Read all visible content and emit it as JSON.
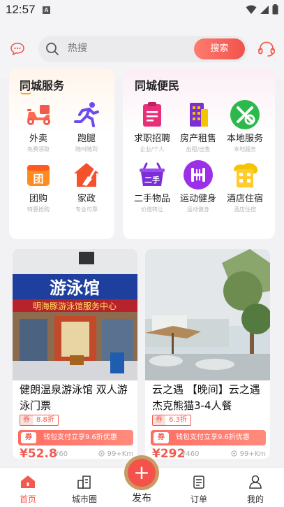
{
  "status": {
    "time": "12:57",
    "notif_badge": "A"
  },
  "search": {
    "placeholder": "热搜",
    "button": "搜索"
  },
  "icons": {
    "message": "message-icon",
    "customer_service": "headset-icon",
    "search": "search-icon"
  },
  "city_service": {
    "title": "同城服务",
    "items": [
      {
        "label": "外卖",
        "sub": "免费领取",
        "icon": "scooter-icon"
      },
      {
        "label": "跑腿",
        "sub": "随叫随到",
        "icon": "runner-icon"
      },
      {
        "label": "团购",
        "sub": "特惠抢购",
        "icon": "group-buy-icon"
      },
      {
        "label": "家政",
        "sub": "专业可靠",
        "icon": "broom-icon"
      }
    ]
  },
  "city_convenience": {
    "title": "同城便民",
    "items": [
      {
        "label": "求职招聘",
        "sub": "企业/个人",
        "icon": "job-icon"
      },
      {
        "label": "房产租售",
        "sub": "出租/出售",
        "icon": "building-icon"
      },
      {
        "label": "本地服务",
        "sub": "本地服务",
        "icon": "tools-icon"
      },
      {
        "label": "二手物品",
        "sub": "价值转让",
        "icon": "basket-icon"
      },
      {
        "label": "运动健身",
        "sub": "运动健身",
        "icon": "fitness-icon"
      },
      {
        "label": "酒店住宿",
        "sub": "酒店住宿",
        "icon": "hotel-icon"
      }
    ]
  },
  "products": [
    {
      "title": "健朗温泉游泳馆 双人游泳门票",
      "coupon_tag": "券",
      "coupon_value": "8.8折",
      "pay_icon": "券",
      "pay_text": "钱包支付立享9.6折优惠",
      "price": "¥52.8",
      "old_price": "¥60",
      "distance": "99+Km",
      "sign_text": "游泳馆",
      "banner_text": "明海豚游泳馆服务中心"
    },
    {
      "title": "云之遇 【晚间】云之遇杰克熊猫3-4人餐",
      "coupon_tag": "券",
      "coupon_value": "6.3折",
      "pay_icon": "券",
      "pay_text": "钱包支付立享9.6折优惠",
      "price": "¥292",
      "old_price": "¥460",
      "distance": "99+Km"
    }
  ],
  "bottom_nav": {
    "home": "首页",
    "city_circle": "城市圈",
    "publish": "发布",
    "orders": "订单",
    "mine": "我的"
  },
  "colors": {
    "accent": "#f35a4f",
    "gold": "#f5a623"
  }
}
